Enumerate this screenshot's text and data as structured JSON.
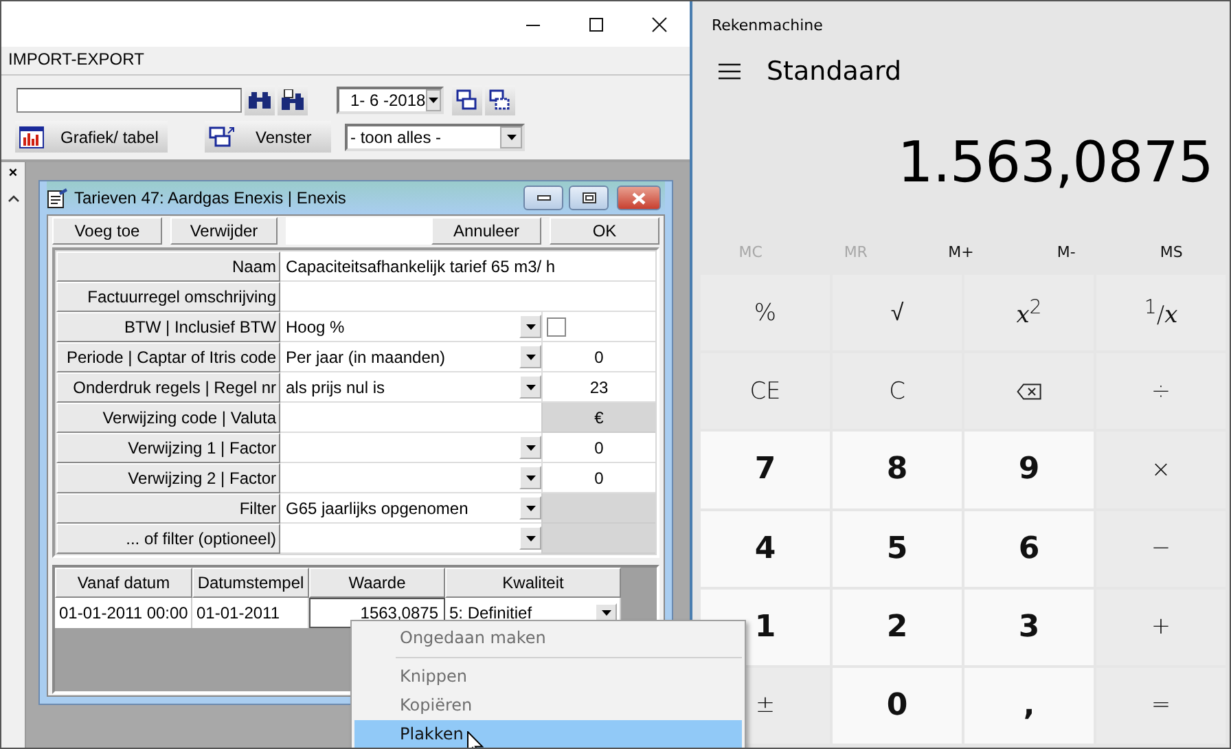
{
  "app_window": {
    "menu": "IMPORT-EXPORT",
    "date_field": "1- 6 -2018",
    "buttons": [
      {
        "label": "Grafiek/ tabel",
        "kind": "chart"
      },
      {
        "label": "Venster",
        "kind": "window"
      }
    ],
    "view_filter": "- toon alles -",
    "side_controls": [
      "×"
    ]
  },
  "dialog": {
    "title": "Tarieven 47: Aardgas Enexis | Enexis",
    "buttons_left": [
      "Voeg toe",
      "Verwijder"
    ],
    "buttons_right": [
      "Annuleer",
      "OK"
    ],
    "fields": [
      {
        "label": "Naam",
        "value": "Capaciteitsafhankelijk tarief 65 m3/ h",
        "dropdown": false,
        "extra": {
          "kind": "none"
        }
      },
      {
        "label": "Factuurregel omschrijving",
        "dropdown": false,
        "extra": {
          "kind": "none"
        }
      },
      {
        "label": "BTW | Inclusief BTW",
        "value": "Hoog %",
        "dropdown": true,
        "extra": {
          "kind": "checkbox",
          "checked": false
        }
      },
      {
        "label": "Periode | Captar of Itris code",
        "value": "Per jaar (in maanden)",
        "dropdown": true,
        "extra": {
          "kind": "number",
          "text": "0"
        }
      },
      {
        "label": "Onderdruk regels | Regel nr",
        "value": "als prijs nul is",
        "dropdown": true,
        "extra": {
          "kind": "number",
          "text": "23"
        }
      },
      {
        "label": "Verwijzing code | Valuta",
        "dropdown": false,
        "extra": {
          "kind": "locked",
          "text": "€"
        }
      },
      {
        "label": "Verwijzing 1 | Factor",
        "dropdown": true,
        "extra": {
          "kind": "number",
          "text": "0"
        }
      },
      {
        "label": "Verwijzing 2 | Factor",
        "dropdown": true,
        "extra": {
          "kind": "number",
          "text": "0"
        }
      },
      {
        "label": "Filter",
        "value": "G65 jaarlijks opgenomen",
        "dropdown": true,
        "extra": {
          "kind": "locked"
        }
      },
      {
        "label": "... of filter (optioneel)",
        "dropdown": true,
        "extra": {
          "kind": "locked"
        }
      }
    ],
    "grid": {
      "columns": [
        "Vanaf datum",
        "Datumstempel",
        "Waarde",
        "Kwaliteit"
      ],
      "rows": [
        [
          "01-01-2011 00:00",
          "01-01-2011",
          "1563,0875",
          "5: Definitief"
        ]
      ]
    }
  },
  "context_menu": [
    {
      "kind": "item",
      "label": "Ongedaan maken",
      "disabled": true,
      "selected": false
    },
    {
      "kind": "separator"
    },
    {
      "kind": "item",
      "label": "Knippen",
      "disabled": true,
      "selected": false
    },
    {
      "kind": "item",
      "label": "Kopiëren",
      "disabled": true,
      "selected": false
    },
    {
      "kind": "item",
      "label": "Plakken",
      "disabled": false,
      "selected": true
    }
  ],
  "calculator": {
    "title": "Rekenmachine",
    "mode": "Standaard",
    "display": "1.563,0875",
    "memory": [
      {
        "label": "MC",
        "disabled": true
      },
      {
        "label": "MR",
        "disabled": true
      },
      {
        "label": "M+",
        "disabled": false
      },
      {
        "label": "M-",
        "disabled": false
      },
      {
        "label": "MS",
        "disabled": false
      }
    ],
    "keys": [
      {
        "label": "%",
        "kind": "op"
      },
      {
        "label": "√",
        "kind": "op"
      },
      {
        "label": "*x*$^{2}$",
        "kind": "op"
      },
      {
        "label": "$^{1}$/*x*",
        "kind": "op"
      },
      {
        "label": "CE",
        "kind": "op"
      },
      {
        "label": "C",
        "kind": "op"
      },
      {
        "kind": "backspace"
      },
      {
        "label": "÷",
        "kind": "op"
      },
      {
        "label": "7",
        "kind": "digit"
      },
      {
        "label": "8",
        "kind": "digit"
      },
      {
        "label": "9",
        "kind": "digit"
      },
      {
        "label": "×",
        "kind": "op"
      },
      {
        "label": "4",
        "kind": "digit"
      },
      {
        "label": "5",
        "kind": "digit"
      },
      {
        "label": "6",
        "kind": "digit"
      },
      {
        "label": "−",
        "kind": "op"
      },
      {
        "label": "1",
        "kind": "digit"
      },
      {
        "label": "2",
        "kind": "digit"
      },
      {
        "label": "3",
        "kind": "digit"
      },
      {
        "label": "+",
        "kind": "op"
      },
      {
        "label": "±",
        "kind": "op"
      },
      {
        "label": "0",
        "kind": "digit"
      },
      {
        "label": ",",
        "kind": "digit"
      },
      {
        "label": "=",
        "kind": "op"
      }
    ]
  }
}
